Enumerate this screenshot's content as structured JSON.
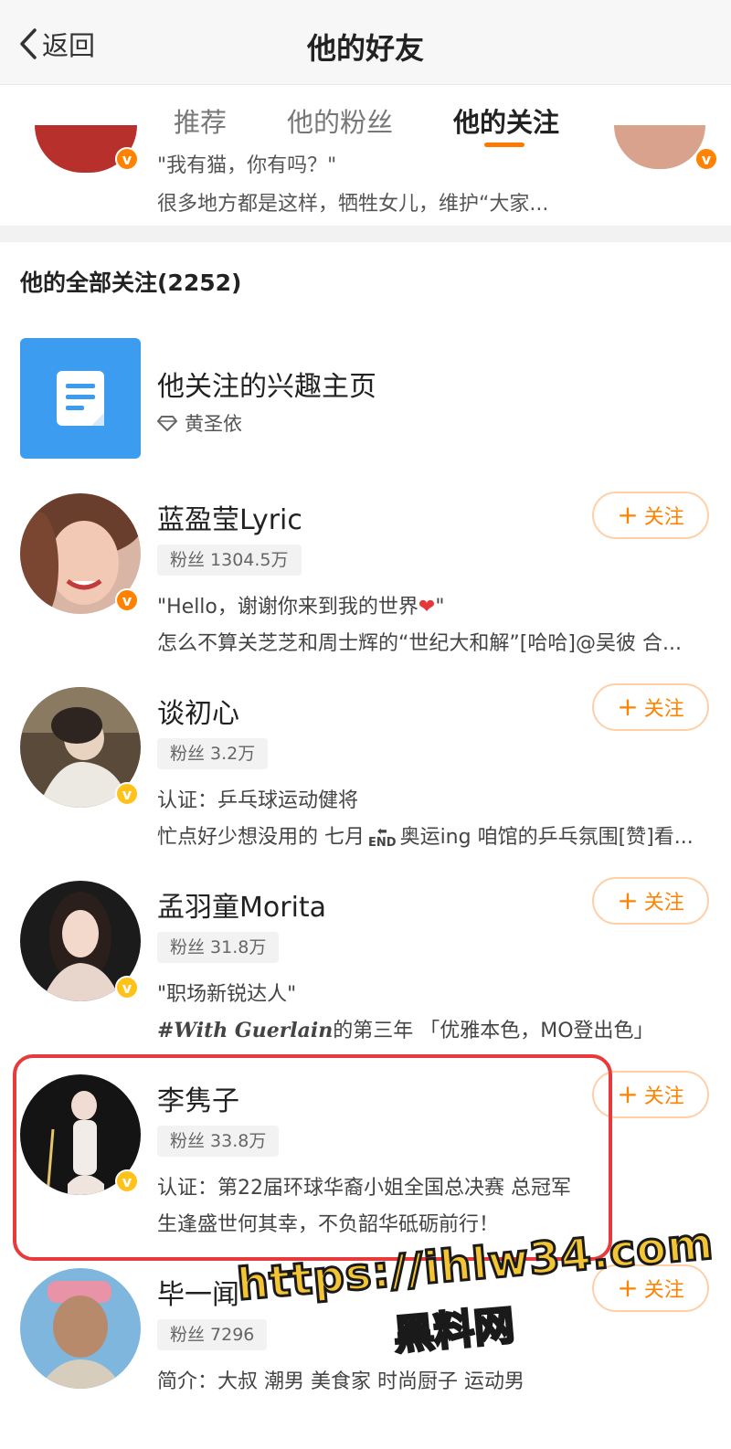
{
  "header": {
    "back_label": "返回",
    "title": "他的好友"
  },
  "tabs": [
    {
      "label": "推荐",
      "active": false
    },
    {
      "label": "他的粉丝",
      "active": false
    },
    {
      "label": "他的关注",
      "active": true
    }
  ],
  "recommended_strip": {
    "line1": "\"我有猫，你有吗？\"",
    "line2": "很多地方都是这样，牺牲女儿，维护“大家..."
  },
  "section_title": "他的全部关注(2252)",
  "interest_page": {
    "name": "他关注的兴趣主页",
    "owner": "黄圣依",
    "icon": "document-icon"
  },
  "follow_label": "关注",
  "users": [
    {
      "name": "蓝盈莹Lyric",
      "fans": "粉丝 1304.5万",
      "line1": "\"Hello，谢谢你来到我的世界",
      "line1_suffix": "\"",
      "line2": "怎么不算关芝芝和周士辉的“世纪大和解”[哈哈]@吴彼 合...",
      "badge": "orange"
    },
    {
      "name": "谈初心",
      "fans": "粉丝 3.2万",
      "line1": "认证：乒乓球运动健将",
      "line2_a": "忙点好少想没用的 七月",
      "line2_b": "奥运ing 咱馆的乒乓氛围[赞]看...",
      "badge": "yellow"
    },
    {
      "name": "孟羽童Morita",
      "fans": "粉丝 31.8万",
      "line1": "\"职场新锐达人\"",
      "line2_a": "#With Guerlain",
      "line2_b": "的第三年 「优雅本色，MO登出色」",
      "badge": "yellow"
    },
    {
      "name": "李隽子",
      "fans": "粉丝 33.8万",
      "line1": "认证：第22届环球华裔小姐全国总决赛 总冠军",
      "line2": "生逢盛世何其幸，不负韶华砥砺前行！",
      "badge": "yellow"
    },
    {
      "name": "毕一闻",
      "fans": "粉丝 7296",
      "line1": "简介：大叔 潮男 美食家 时尚厨子 运动男",
      "badge": "none"
    }
  ],
  "watermark": {
    "url": "https://ihlw34.com",
    "text": "黑料网"
  },
  "colors": {
    "accent": "#ff8200",
    "verified_orange": "#ff8200",
    "verified_yellow": "#ffc21a",
    "highlight_border": "#e83a3a",
    "interest_icon_bg": "#3b9cf0"
  }
}
